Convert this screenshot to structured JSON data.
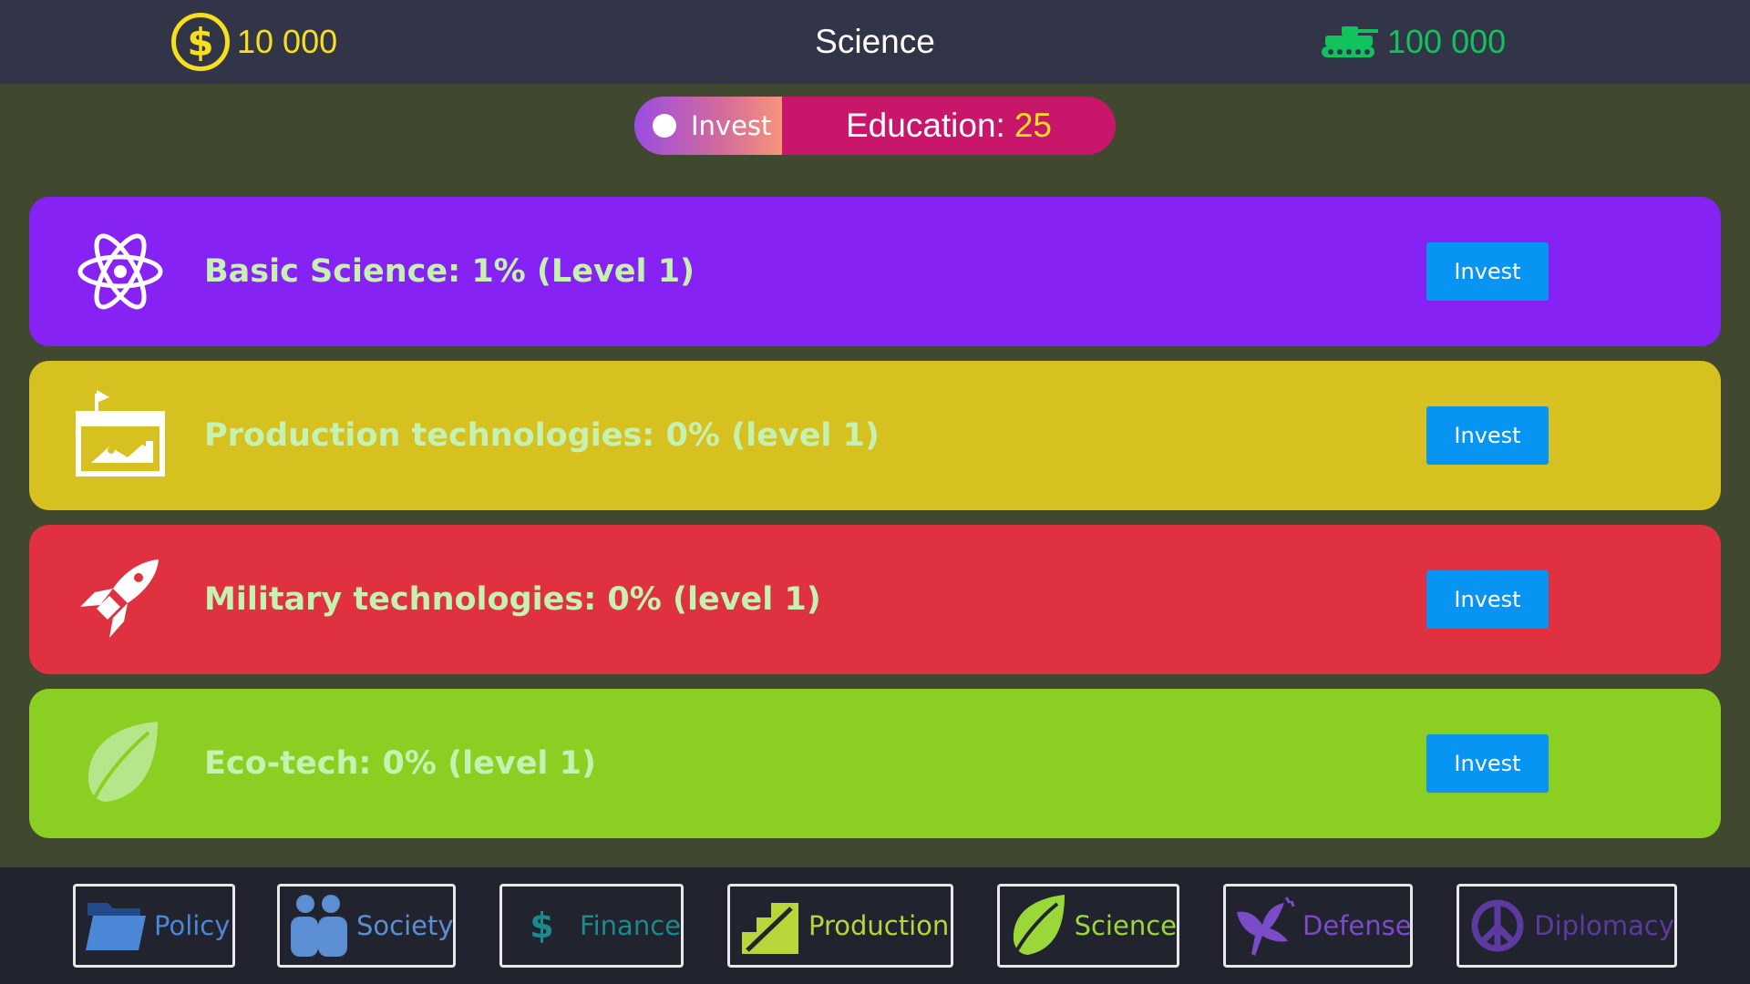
{
  "header": {
    "money": "10 000",
    "title": "Science",
    "army": "100 000",
    "colors": {
      "money": "#f6df1c",
      "army": "#12c25c"
    }
  },
  "education": {
    "toggle_label": "Invest",
    "label": "Education:",
    "value": "25"
  },
  "cards": [
    {
      "label": "Basic Science: 1% (Level 1)",
      "button": "Invest",
      "color": "#8722f5",
      "icon": "atom-icon"
    },
    {
      "label": "Production technologies: 0% (level 1)",
      "button": "Invest",
      "color": "#d6c120",
      "icon": "factory-icon"
    },
    {
      "label": "Military technologies: 0% (level 1)",
      "button": "Invest",
      "color": "#e03140",
      "icon": "rocket-icon"
    },
    {
      "label": "Eco-tech: 0% (level 1)",
      "button": "Invest",
      "color": "#8acf22",
      "icon": "leaf-icon"
    }
  ],
  "nav": [
    {
      "label": "Policy",
      "icon": "folder-icon",
      "color": "#4c86d6"
    },
    {
      "label": "Society",
      "icon": "people-icon",
      "color": "#5b8ed2"
    },
    {
      "label": "Finance",
      "icon": "dollar-icon",
      "color": "#1b8a8a"
    },
    {
      "label": "Production",
      "icon": "stairs-icon",
      "color": "#b6d63a"
    },
    {
      "label": "Science",
      "icon": "leaf-icon",
      "color": "#9ad83a"
    },
    {
      "label": "Defense",
      "icon": "dove-icon",
      "color": "#7a4cc8"
    },
    {
      "label": "Diplomacy",
      "icon": "peace-icon",
      "color": "#5c3aa0"
    }
  ]
}
